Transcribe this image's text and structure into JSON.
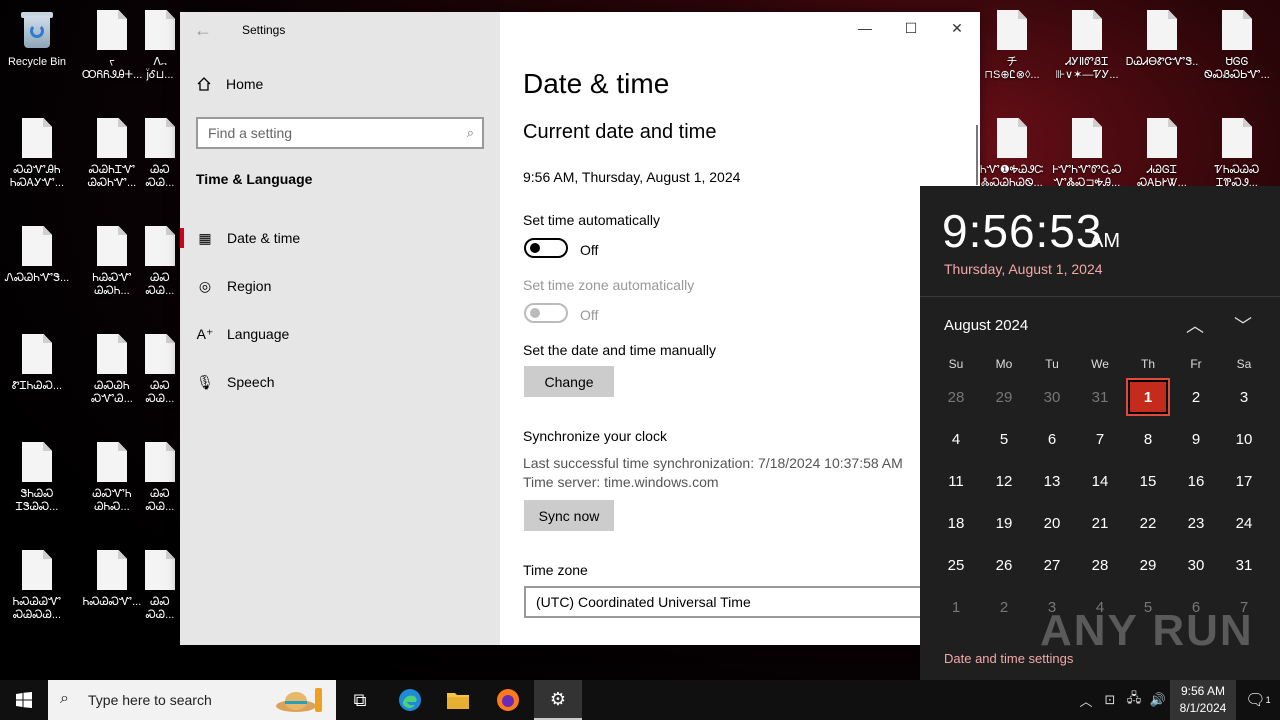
{
  "desktop": {
    "icons": [
      {
        "label": "Recycle Bin",
        "type": "bin"
      },
      {
        "label": "ᡪ\nꝎᏲᏲᏭᎯⵜ...",
        "type": "file"
      },
      {
        "label": "ᐱ᎔\nj̈Ꮄ⊔...",
        "type": "file"
      },
      {
        "label": "ᛏᛟᎰᎷ\nᎷᏉ⊗...",
        "type": "file"
      },
      {
        "label": "ᏍᏆᎩᏍᏍ\nᎪᏏᏕ...",
        "type": "file"
      },
      {
        "label": "ᏛᏊᏲ\nᎯᏍᎦ...",
        "type": "file"
      },
      {
        "label": "ᛗᎥᏈ\nᏍᏔᏂ...",
        "type": "file"
      }
    ],
    "right_icons": [
      {
        "label": "チ\n⊓S⊕Ꮭ⊗◊...",
        "type": "file"
      },
      {
        "label": "ᏗᎩⅡᏛᏰᏆ\n⊪∨✶—ᏤᎩ...",
        "type": "file"
      },
      {
        "label": "ᎠᏊᏗᎾᏑᏣᏉᏕ...",
        "type": "file"
      },
      {
        "label": "ᏌᎶᎶ\nᏫᏍᏰᏍᏏᏉ...",
        "type": "file"
      },
      {
        "label": "ᏂᏉ❶ᎭᏊᏭᏨ\nᏜᏍᏊᏂᏊᏫ...",
        "type": "file"
      },
      {
        "label": "ᎰᏉᏂᏉᏛᏩᏍ\nᏉᏜᏍ⊐ᎭᎯ...",
        "type": "file"
      },
      {
        "label": "ᏗᏊᎶᏆ\nᏍᎪᏏᎨᏔ...",
        "type": "file"
      },
      {
        "label": "ᏤᏂᏍᏊᏍ\nᏆᏈᏍᏭ...",
        "type": "file"
      }
    ],
    "col1_labels": [
      "ᏍᏊᏉᎯᏂ\nᏂᏍᎪᎩᏉ...",
      "ᏁᏍᏊᏂᏉᏕ...",
      "ᏑᏆᏂᏊᏍ...",
      "ᏕᏂᏊᏍ\nᏆᏕᏊᏍ...",
      "ᏂᏍᏊᏊᏉ\nᏍᏊᏍᏊ..."
    ],
    "col2_labels": [
      "ᏍᏊᏂᏆᏉ\nᏊᏍᏂᏉ...",
      "ᏂᏊᏍᏉ\nᏊᏍᏂ...",
      "ᏊᏍᏊᏂ\nᏍᏉᏊ...",
      "ᏊᏍᏉᏂ\nᏊᏂᏍ...",
      "ᏂᏍᏊᏍᏉ..."
    ],
    "col3_labels": [
      "ᏊᏍ\nᏍᏊ...",
      "ᏊᏍ\nᏍᏊ...",
      "ᏊᏍ\nᏍᏊ...",
      "ᏊᏍ\nᏍᏊ...",
      "ᏊᏍ\nᏍᏊ..."
    ]
  },
  "settings": {
    "window_title": "Settings",
    "back_label": "←",
    "home_label": "Home",
    "search_placeholder": "Find a setting",
    "section_title": "Time & Language",
    "nav_items": [
      {
        "label": "Date & time",
        "icon": "calendar-clock-icon",
        "active": true
      },
      {
        "label": "Region",
        "icon": "globe-icon",
        "active": false
      },
      {
        "label": "Language",
        "icon": "language-icon",
        "active": false
      },
      {
        "label": "Speech",
        "icon": "microphone-icon",
        "active": false
      }
    ],
    "page_title": "Date & time",
    "current_heading": "Current date and time",
    "current_value": "9:56 AM, Thursday, August 1, 2024",
    "set_time_auto_label": "Set time automatically",
    "set_time_auto_state": "Off",
    "set_tz_auto_label": "Set time zone automatically",
    "set_tz_auto_state": "Off",
    "manual_label": "Set the date and time manually",
    "change_button": "Change",
    "sync_heading": "Synchronize your clock",
    "sync_last": "Last successful time synchronization: 7/18/2024 10:37:58 AM",
    "sync_server": "Time server: time.windows.com",
    "sync_button": "Sync now",
    "timezone_label": "Time zone",
    "timezone_value": "(UTC) Coordinated Universal Time"
  },
  "flyout": {
    "time": "9:56:53",
    "ampm": "AM",
    "date": "Thursday, August 1, 2024",
    "month_label": "August 2024",
    "weekdays": [
      "Su",
      "Mo",
      "Tu",
      "We",
      "Th",
      "Fr",
      "Sa"
    ],
    "weeks": [
      [
        "28",
        "29",
        "30",
        "31",
        "1",
        "2",
        "3"
      ],
      [
        "4",
        "5",
        "6",
        "7",
        "8",
        "9",
        "10"
      ],
      [
        "11",
        "12",
        "13",
        "14",
        "15",
        "16",
        "17"
      ],
      [
        "18",
        "19",
        "20",
        "21",
        "22",
        "23",
        "24"
      ],
      [
        "25",
        "26",
        "27",
        "28",
        "29",
        "30",
        "31"
      ],
      [
        "1",
        "2",
        "3",
        "4",
        "5",
        "6",
        "7"
      ]
    ],
    "today": "1",
    "settings_link": "Date and time settings",
    "watermark": "ANY RUN"
  },
  "taskbar": {
    "search_placeholder": "Type here to search",
    "clock_time": "9:56 AM",
    "clock_date": "8/1/2024",
    "notification_count": "1"
  }
}
